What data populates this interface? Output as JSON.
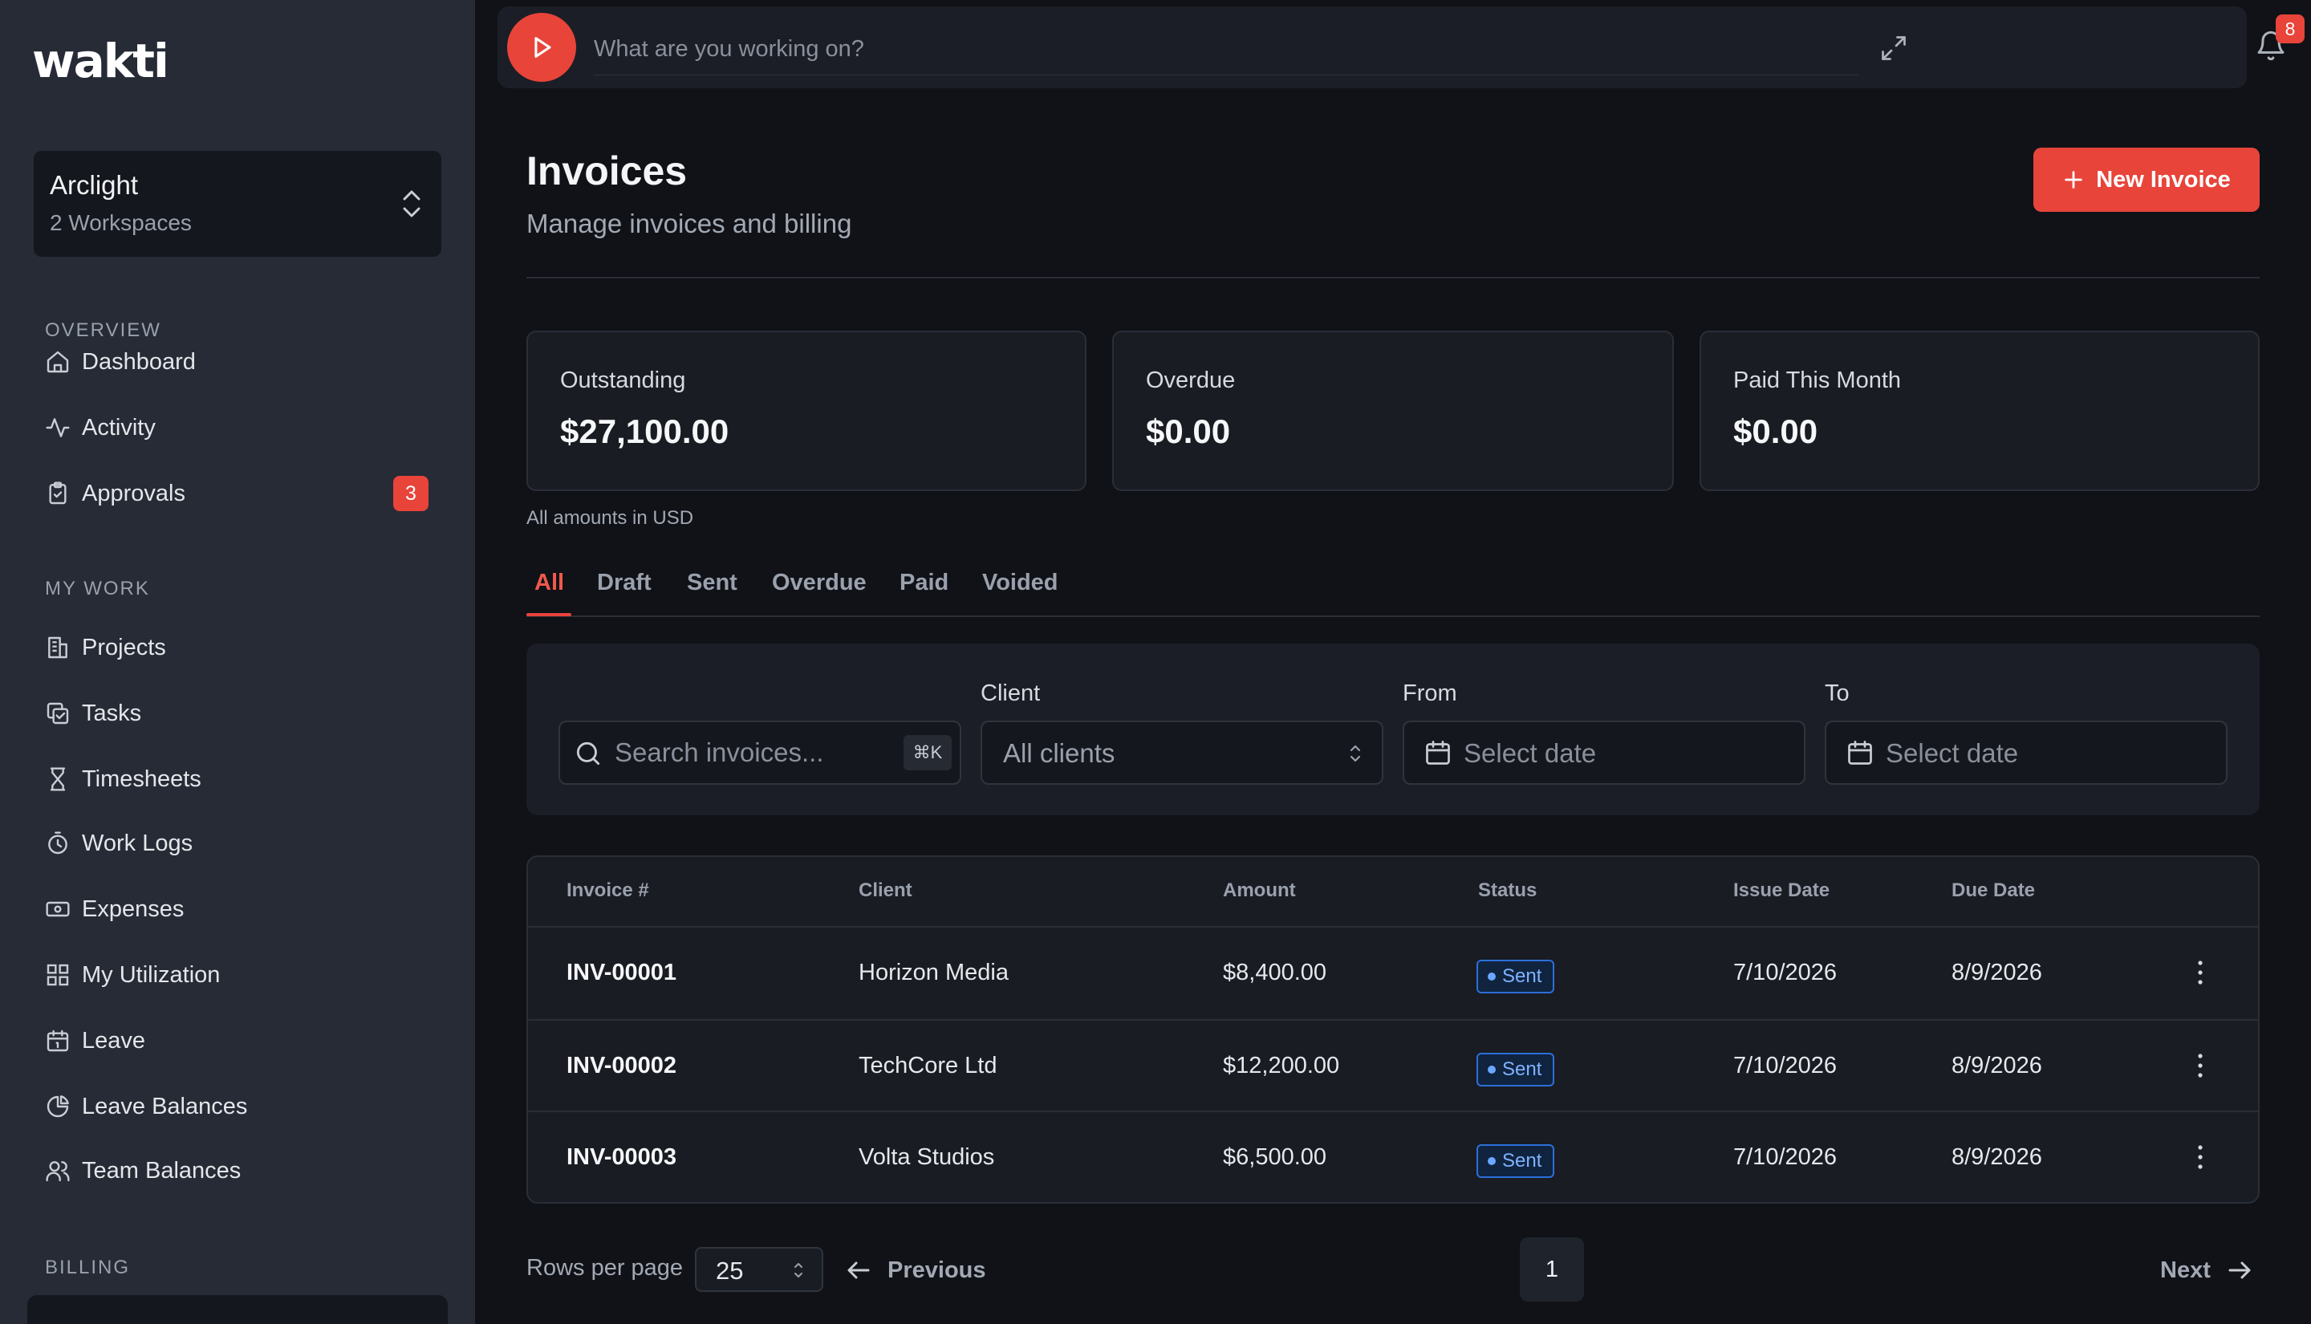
{
  "app": {
    "logo_text": "wakti"
  },
  "workspace": {
    "name": "Arclight",
    "subtitle": "2 Workspaces"
  },
  "sidebar": {
    "sections": [
      {
        "label": "OVERVIEW"
      },
      {
        "label": "MY WORK"
      },
      {
        "label": "BILLING"
      }
    ],
    "items": [
      {
        "label": "Dashboard",
        "icon": "home-icon"
      },
      {
        "label": "Activity",
        "icon": "activity-icon"
      },
      {
        "label": "Approvals",
        "icon": "clipboard-check-icon",
        "badge": "3"
      },
      {
        "label": "Projects",
        "icon": "building-icon"
      },
      {
        "label": "Tasks",
        "icon": "copy-check-icon"
      },
      {
        "label": "Timesheets",
        "icon": "hourglass-icon"
      },
      {
        "label": "Work Logs",
        "icon": "timer-icon"
      },
      {
        "label": "Expenses",
        "icon": "banknote-icon"
      },
      {
        "label": "My Utilization",
        "icon": "grid-icon"
      },
      {
        "label": "Leave",
        "icon": "calendar-icon"
      },
      {
        "label": "Leave Balances",
        "icon": "pie-chart-icon"
      },
      {
        "label": "Team Balances",
        "icon": "users-icon"
      }
    ]
  },
  "topbar": {
    "timer_placeholder": "What are you working on?",
    "notifications_count": "8"
  },
  "header": {
    "title": "Invoices",
    "subtitle": "Manage invoices and billing",
    "new_button": "New Invoice"
  },
  "stats": [
    {
      "label": "Outstanding",
      "value": "$27,100.00"
    },
    {
      "label": "Overdue",
      "value": "$0.00"
    },
    {
      "label": "Paid This Month",
      "value": "$0.00"
    }
  ],
  "currency_note": "All amounts in USD",
  "tabs": [
    {
      "label": "All",
      "active": true
    },
    {
      "label": "Draft"
    },
    {
      "label": "Sent"
    },
    {
      "label": "Overdue"
    },
    {
      "label": "Paid"
    },
    {
      "label": "Voided"
    }
  ],
  "filters": {
    "search_placeholder": "Search invoices...",
    "search_shortcut": "⌘K",
    "client_label": "Client",
    "client_value": "All clients",
    "from_label": "From",
    "from_placeholder": "Select date",
    "to_label": "To",
    "to_placeholder": "Select date"
  },
  "table": {
    "headers": [
      "Invoice #",
      "Client",
      "Amount",
      "Status",
      "Issue Date",
      "Due Date"
    ],
    "rows": [
      {
        "invoice": "INV-00001",
        "client": "Horizon Media",
        "amount": "$8,400.00",
        "status": "Sent",
        "issue": "7/10/2026",
        "due": "8/9/2026"
      },
      {
        "invoice": "INV-00002",
        "client": "TechCore Ltd",
        "amount": "$12,200.00",
        "status": "Sent",
        "issue": "7/10/2026",
        "due": "8/9/2026"
      },
      {
        "invoice": "INV-00003",
        "client": "Volta Studios",
        "amount": "$6,500.00",
        "status": "Sent",
        "issue": "7/10/2026",
        "due": "8/9/2026"
      }
    ]
  },
  "pagination": {
    "rows_per_page_label": "Rows per page",
    "rows_per_page": "25",
    "previous": "Previous",
    "current_page": "1",
    "next": "Next"
  },
  "colors": {
    "accent": "#e8443a",
    "sidebar_bg": "#262b36",
    "page_bg": "#101217",
    "status_sent": "#2d6fd9"
  }
}
